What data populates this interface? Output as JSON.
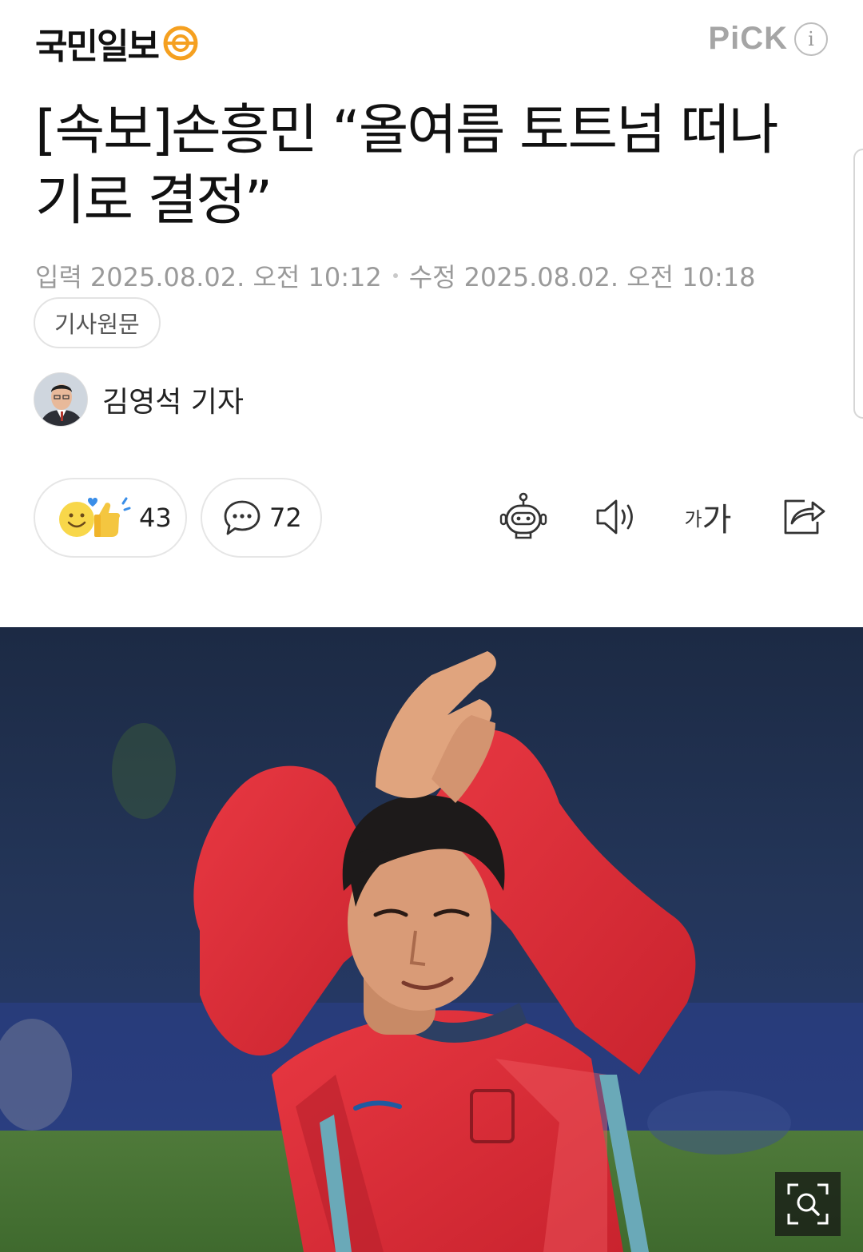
{
  "header": {
    "logo_text": "국민일보",
    "pick_label": "PiCK",
    "info_label": "i"
  },
  "article": {
    "headline": "[속보]손흥민 “올여름 토트넘 떠나기로 결정”",
    "published_label": "입력",
    "published_value": "2025.08.02. 오전 10:12",
    "modified_label": "수정",
    "modified_value": "2025.08.02. 오전 10:18",
    "original_button": "기사원문"
  },
  "author": {
    "name": "김영석 기자"
  },
  "reactions": {
    "reaction_count": "43",
    "comment_count": "72"
  },
  "toolbar": {
    "font_small": "가",
    "font_big": "가",
    "icons": [
      "robot-summary-icon",
      "speaker-icon",
      "font-size-icon",
      "share-icon"
    ]
  },
  "colors": {
    "logo_accent": "#f5a020",
    "muted_text": "#9a9a9a",
    "photo_jersey": "#e0313c"
  }
}
